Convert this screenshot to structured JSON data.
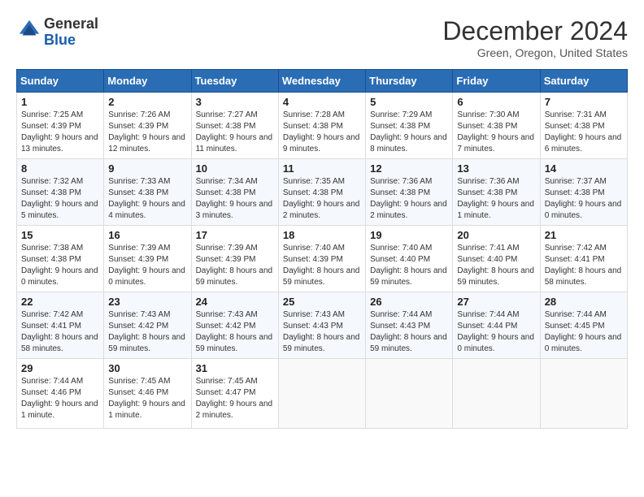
{
  "logo": {
    "line1": "General",
    "line2": "Blue"
  },
  "header": {
    "title": "December 2024",
    "location": "Green, Oregon, United States"
  },
  "weekdays": [
    "Sunday",
    "Monday",
    "Tuesday",
    "Wednesday",
    "Thursday",
    "Friday",
    "Saturday"
  ],
  "weeks": [
    [
      {
        "day": "1",
        "sunrise": "7:25 AM",
        "sunset": "4:39 PM",
        "daylight": "9 hours and 13 minutes."
      },
      {
        "day": "2",
        "sunrise": "7:26 AM",
        "sunset": "4:39 PM",
        "daylight": "9 hours and 12 minutes."
      },
      {
        "day": "3",
        "sunrise": "7:27 AM",
        "sunset": "4:38 PM",
        "daylight": "9 hours and 11 minutes."
      },
      {
        "day": "4",
        "sunrise": "7:28 AM",
        "sunset": "4:38 PM",
        "daylight": "9 hours and 9 minutes."
      },
      {
        "day": "5",
        "sunrise": "7:29 AM",
        "sunset": "4:38 PM",
        "daylight": "9 hours and 8 minutes."
      },
      {
        "day": "6",
        "sunrise": "7:30 AM",
        "sunset": "4:38 PM",
        "daylight": "9 hours and 7 minutes."
      },
      {
        "day": "7",
        "sunrise": "7:31 AM",
        "sunset": "4:38 PM",
        "daylight": "9 hours and 6 minutes."
      }
    ],
    [
      {
        "day": "8",
        "sunrise": "7:32 AM",
        "sunset": "4:38 PM",
        "daylight": "9 hours and 5 minutes."
      },
      {
        "day": "9",
        "sunrise": "7:33 AM",
        "sunset": "4:38 PM",
        "daylight": "9 hours and 4 minutes."
      },
      {
        "day": "10",
        "sunrise": "7:34 AM",
        "sunset": "4:38 PM",
        "daylight": "9 hours and 3 minutes."
      },
      {
        "day": "11",
        "sunrise": "7:35 AM",
        "sunset": "4:38 PM",
        "daylight": "9 hours and 2 minutes."
      },
      {
        "day": "12",
        "sunrise": "7:36 AM",
        "sunset": "4:38 PM",
        "daylight": "9 hours and 2 minutes."
      },
      {
        "day": "13",
        "sunrise": "7:36 AM",
        "sunset": "4:38 PM",
        "daylight": "9 hours and 1 minute."
      },
      {
        "day": "14",
        "sunrise": "7:37 AM",
        "sunset": "4:38 PM",
        "daylight": "9 hours and 0 minutes."
      }
    ],
    [
      {
        "day": "15",
        "sunrise": "7:38 AM",
        "sunset": "4:38 PM",
        "daylight": "9 hours and 0 minutes."
      },
      {
        "day": "16",
        "sunrise": "7:39 AM",
        "sunset": "4:39 PM",
        "daylight": "9 hours and 0 minutes."
      },
      {
        "day": "17",
        "sunrise": "7:39 AM",
        "sunset": "4:39 PM",
        "daylight": "8 hours and 59 minutes."
      },
      {
        "day": "18",
        "sunrise": "7:40 AM",
        "sunset": "4:39 PM",
        "daylight": "8 hours and 59 minutes."
      },
      {
        "day": "19",
        "sunrise": "7:40 AM",
        "sunset": "4:40 PM",
        "daylight": "8 hours and 59 minutes."
      },
      {
        "day": "20",
        "sunrise": "7:41 AM",
        "sunset": "4:40 PM",
        "daylight": "8 hours and 59 minutes."
      },
      {
        "day": "21",
        "sunrise": "7:42 AM",
        "sunset": "4:41 PM",
        "daylight": "8 hours and 58 minutes."
      }
    ],
    [
      {
        "day": "22",
        "sunrise": "7:42 AM",
        "sunset": "4:41 PM",
        "daylight": "8 hours and 58 minutes."
      },
      {
        "day": "23",
        "sunrise": "7:43 AM",
        "sunset": "4:42 PM",
        "daylight": "8 hours and 59 minutes."
      },
      {
        "day": "24",
        "sunrise": "7:43 AM",
        "sunset": "4:42 PM",
        "daylight": "8 hours and 59 minutes."
      },
      {
        "day": "25",
        "sunrise": "7:43 AM",
        "sunset": "4:43 PM",
        "daylight": "8 hours and 59 minutes."
      },
      {
        "day": "26",
        "sunrise": "7:44 AM",
        "sunset": "4:43 PM",
        "daylight": "8 hours and 59 minutes."
      },
      {
        "day": "27",
        "sunrise": "7:44 AM",
        "sunset": "4:44 PM",
        "daylight": "9 hours and 0 minutes."
      },
      {
        "day": "28",
        "sunrise": "7:44 AM",
        "sunset": "4:45 PM",
        "daylight": "9 hours and 0 minutes."
      }
    ],
    [
      {
        "day": "29",
        "sunrise": "7:44 AM",
        "sunset": "4:46 PM",
        "daylight": "9 hours and 1 minute."
      },
      {
        "day": "30",
        "sunrise": "7:45 AM",
        "sunset": "4:46 PM",
        "daylight": "9 hours and 1 minute."
      },
      {
        "day": "31",
        "sunrise": "7:45 AM",
        "sunset": "4:47 PM",
        "daylight": "9 hours and 2 minutes."
      },
      null,
      null,
      null,
      null
    ]
  ],
  "labels": {
    "sunrise": "Sunrise:",
    "sunset": "Sunset:",
    "daylight": "Daylight:"
  }
}
